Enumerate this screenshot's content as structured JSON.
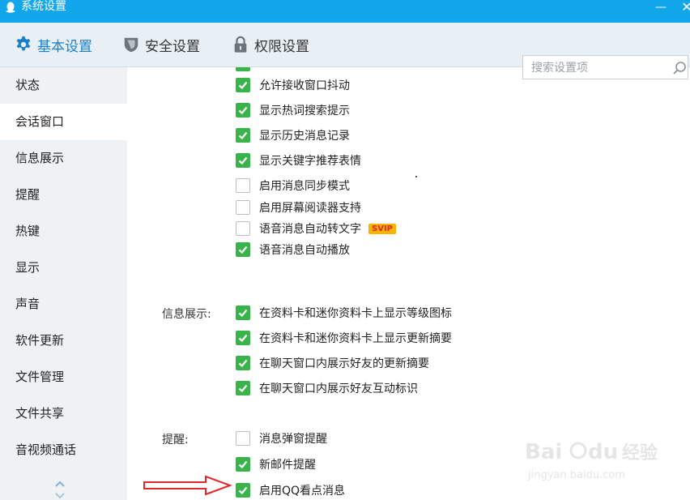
{
  "window": {
    "title": "系统设置",
    "minimize_glyph": "—",
    "close_glyph": "✕"
  },
  "tabs": [
    {
      "label": "基本设置",
      "icon": "gear-icon",
      "active": true
    },
    {
      "label": "安全设置",
      "icon": "shield-icon",
      "active": false
    },
    {
      "label": "权限设置",
      "icon": "lock-icon",
      "active": false
    }
  ],
  "search": {
    "placeholder": "搜索设置项",
    "value": ""
  },
  "sidebar": {
    "items": [
      {
        "label": "状态"
      },
      {
        "label": "会话窗口",
        "active": true
      },
      {
        "label": "信息展示"
      },
      {
        "label": "提醒"
      },
      {
        "label": "热键"
      },
      {
        "label": "显示"
      },
      {
        "label": "声音"
      },
      {
        "label": "软件更新"
      },
      {
        "label": "文件管理"
      },
      {
        "label": "文件共享"
      },
      {
        "label": "音视频通话"
      }
    ]
  },
  "session": {
    "options": [
      {
        "label": "允许接收窗口抖动",
        "checked": true
      },
      {
        "label": "显示热词搜索提示",
        "checked": true
      },
      {
        "label": "显示历史消息记录",
        "checked": true
      },
      {
        "label": "显示关键字推荐表情",
        "checked": true
      },
      {
        "label": "启用消息同步模式",
        "checked": false
      },
      {
        "label": "启用屏幕阅读器支持",
        "checked": false
      },
      {
        "label": "语音消息自动转文字",
        "checked": false,
        "badge": "SVIP"
      },
      {
        "label": "语音消息自动播放",
        "checked": true
      }
    ]
  },
  "info_display": {
    "label": "信息展示:",
    "options": [
      {
        "label": "在资料卡和迷你资料卡上显示等级图标",
        "checked": true
      },
      {
        "label": "在资料卡和迷你资料卡上显示更新摘要",
        "checked": true
      },
      {
        "label": "在聊天窗口内展示好友的更新摘要",
        "checked": true
      },
      {
        "label": "在聊天窗口内展示好友互动标识",
        "checked": true
      }
    ]
  },
  "reminder": {
    "label": "提醒:",
    "options": [
      {
        "label": "消息弹窗提醒",
        "checked": false
      },
      {
        "label": "新邮件提醒",
        "checked": true
      },
      {
        "label": "启用QQ看点消息",
        "checked": true
      }
    ]
  },
  "colors": {
    "titlebar": "#12a6ec",
    "checked": "#39b44a",
    "active_tab": "#1a7fcb",
    "arrow": "#e02a2a"
  }
}
